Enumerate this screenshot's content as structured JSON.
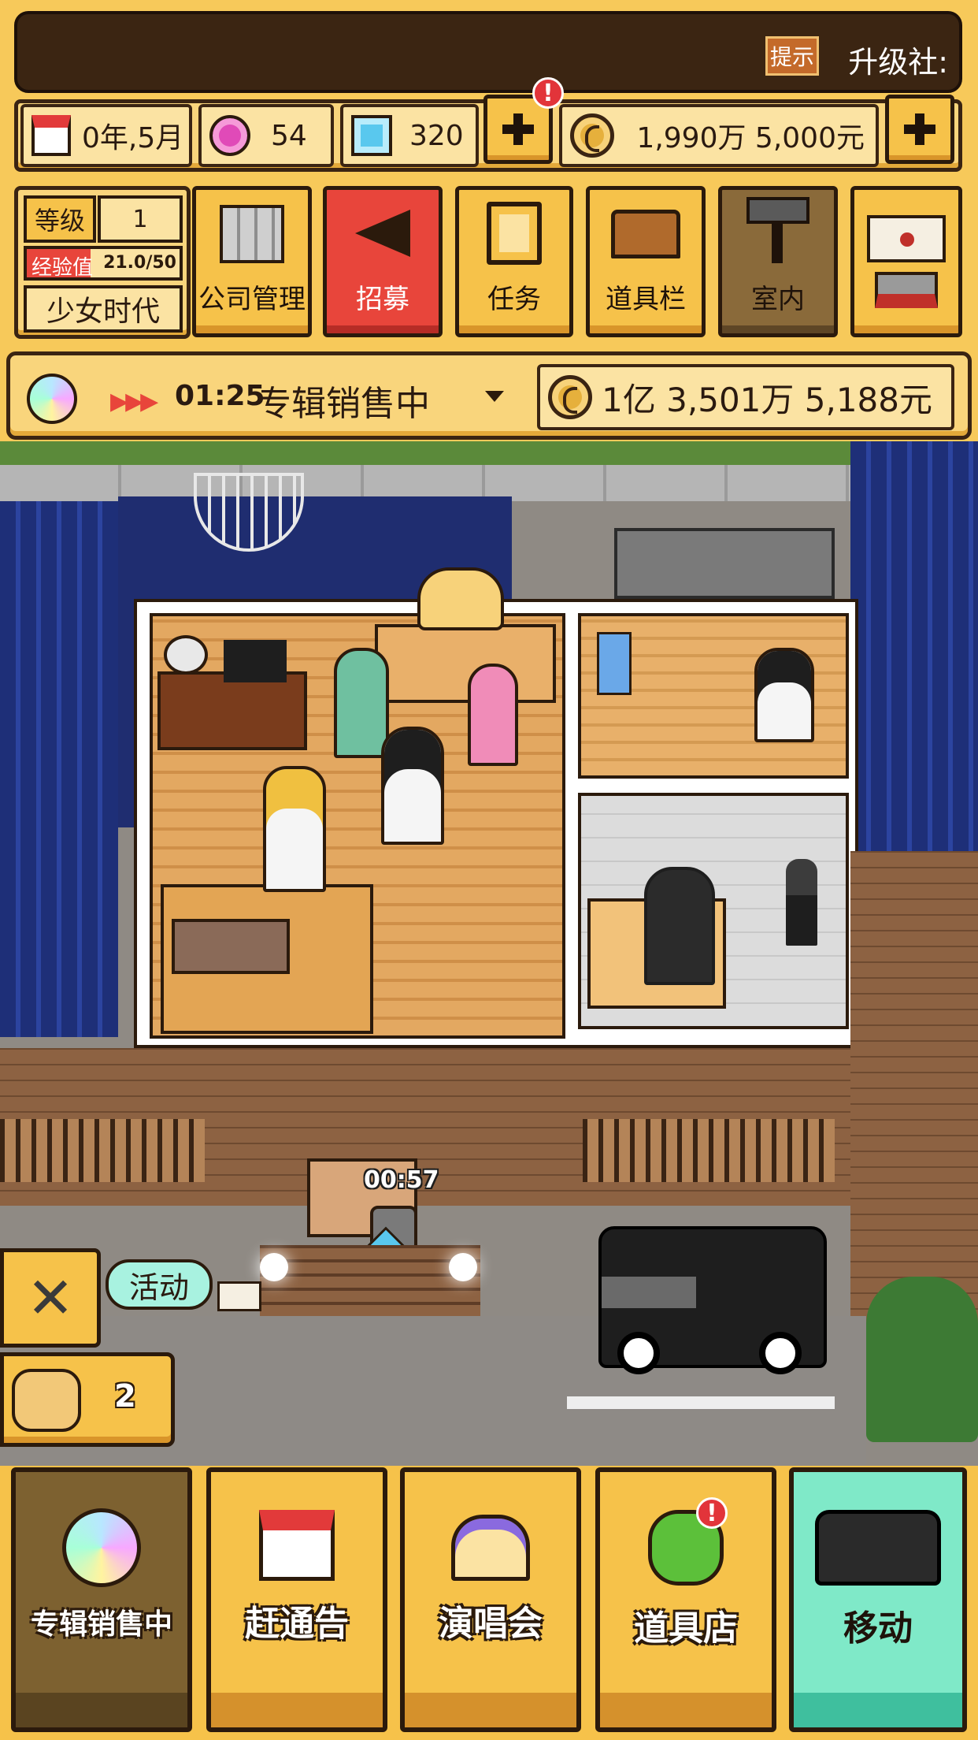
{
  "header": {
    "ticker_tag": "提示",
    "ticker_text": "升级社:"
  },
  "resources": {
    "date": "0年,5月",
    "pink_gems": "54",
    "diamonds": "320",
    "money": "1,990万 5,000元"
  },
  "profile": {
    "level_label": "等级",
    "level_value": "1",
    "exp_label": "经验值",
    "exp_value": "21.0/50",
    "exp_progress": 0.42,
    "group_name": "少女时代"
  },
  "menu": [
    {
      "label": "公司管理",
      "icon": "building-icon"
    },
    {
      "label": "招募",
      "icon": "megaphone-icon"
    },
    {
      "label": "任务",
      "icon": "scroll-icon"
    },
    {
      "label": "道具栏",
      "icon": "chest-icon"
    },
    {
      "label": "室内",
      "icon": "paint-roller-icon"
    }
  ],
  "status": {
    "timer": "01:25",
    "activity": "专辑销售中",
    "album_money": "1亿 3,501万 5,188元"
  },
  "scene": {
    "door_timer": "00:57",
    "event_label": "活动",
    "gift_count": "2"
  },
  "bottom_nav": [
    {
      "label": "专辑销售中",
      "icon": "album-disc-icon"
    },
    {
      "label": "赶通告",
      "icon": "calendar-icon"
    },
    {
      "label": "演唱会",
      "icon": "stage-icon"
    },
    {
      "label": "道具店",
      "icon": "clover-icon"
    },
    {
      "label": "移动",
      "icon": "van-icon"
    }
  ],
  "colors": {
    "panel": "#f9d57c",
    "recruit_red": "#e8453b",
    "move_teal": "#7fe9c8",
    "dark": "#2b1a0c"
  }
}
